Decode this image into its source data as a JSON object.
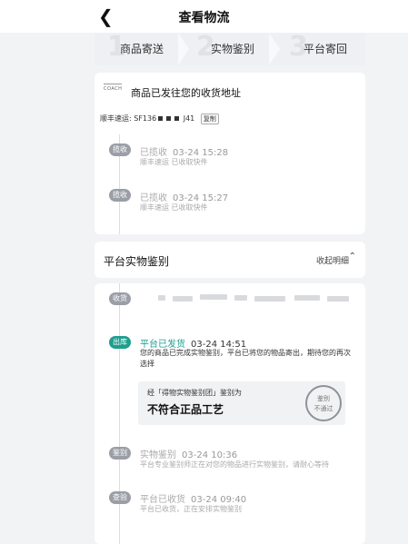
{
  "nav": {
    "back_icon": "chevron-left",
    "title": "查看物流"
  },
  "steps": [
    {
      "num": "1",
      "label": "商品寄送"
    },
    {
      "num": "2",
      "label": "实物鉴别"
    },
    {
      "num": "3",
      "label": "平台寄回"
    }
  ],
  "shipment": {
    "logo_text": "COACH",
    "title": "商品已发往您的收货地址",
    "tracking_prefix": "顺丰速运: SF136",
    "tracking_suffix": "J41",
    "copy_label": "复制"
  },
  "events1": [
    {
      "badge": "揽收",
      "status": "已揽收",
      "time": "03-24 15:28",
      "desc": "顺丰速运 已收取快件"
    },
    {
      "badge": "揽收",
      "status": "已揽收",
      "time": "03-24 15:27",
      "desc": "顺丰速运 已收取快件"
    }
  ],
  "section2": {
    "title": "平台实物鉴别",
    "toggle": "收起明细"
  },
  "events2": {
    "receive_badge": "收货",
    "out": {
      "badge": "出库",
      "status": "平台已发货",
      "time": "03-24 14:51",
      "desc": "您的商品已完成实物鉴别，平台已将您的物品寄出，期待您的再次选择"
    },
    "verdict": {
      "label": "经「得物实物鉴别团」鉴别为",
      "result": "不符合正品工艺",
      "stamp_line1": "鉴别",
      "stamp_line2": "不通过"
    },
    "authenticate": {
      "badge": "鉴别",
      "status": "实物鉴别",
      "time": "03-24 10:36",
      "desc": "平台专业鉴别师正在对您的物品进行实物鉴别，请耐心等待"
    },
    "inspect": {
      "badge": "查验",
      "status": "平台已收货",
      "time": "03-24 09:40",
      "desc": "平台已收货，正在安排实物鉴别"
    }
  }
}
